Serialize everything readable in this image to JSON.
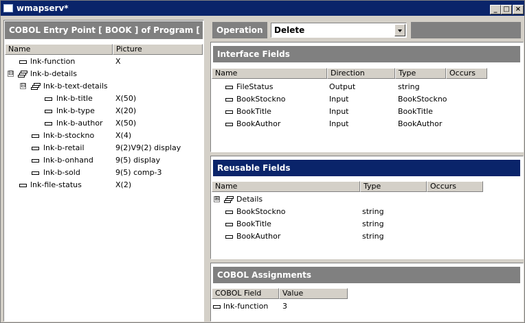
{
  "window": {
    "title": "wmapserv*",
    "min_label": "_",
    "max_label": "□",
    "close_label": "×"
  },
  "left": {
    "header": "COBOL Entry Point [ BOOK ] of Program [ B",
    "columns": [
      "Name",
      "Picture"
    ],
    "rows": [
      {
        "name": "lnk-function",
        "picture": "X",
        "kind": "field"
      },
      {
        "name": "lnk-b-details",
        "picture": "",
        "kind": "group",
        "expander": "⊟"
      },
      {
        "name": "lnk-b-text-details",
        "picture": "",
        "kind": "group",
        "expander": "⊟"
      },
      {
        "name": "lnk-b-title",
        "picture": "X(50)",
        "kind": "field"
      },
      {
        "name": "lnk-b-type",
        "picture": "X(20)",
        "kind": "field"
      },
      {
        "name": "lnk-b-author",
        "picture": "X(50)",
        "kind": "field"
      },
      {
        "name": "lnk-b-stockno",
        "picture": "X(4)",
        "kind": "field"
      },
      {
        "name": "lnk-b-retail",
        "picture": "9(2)V9(2) display",
        "kind": "field"
      },
      {
        "name": "lnk-b-onhand",
        "picture": "9(5) display",
        "kind": "field"
      },
      {
        "name": "lnk-b-sold",
        "picture": "9(5) comp-3",
        "kind": "field"
      },
      {
        "name": "lnk-file-status",
        "picture": "X(2)",
        "kind": "field"
      }
    ]
  },
  "operation": {
    "label": "Operation",
    "value": "Delete"
  },
  "interface": {
    "header": "Interface Fields",
    "columns": [
      "Name",
      "Direction",
      "Type",
      "Occurs"
    ],
    "rows": [
      {
        "name": "FileStatus",
        "direction": "Output",
        "type": "string"
      },
      {
        "name": "BookStockno",
        "direction": "Input",
        "type": "BookStockno"
      },
      {
        "name": "BookTitle",
        "direction": "Input",
        "type": "BookTitle"
      },
      {
        "name": "BookAuthor",
        "direction": "Input",
        "type": "BookAuthor"
      }
    ]
  },
  "reusable": {
    "header": "Reusable Fields",
    "columns": [
      "Name",
      "Type",
      "Occurs"
    ],
    "rows": [
      {
        "name": "Details",
        "type": "",
        "kind": "group",
        "expander": "⊞"
      },
      {
        "name": "BookStockno",
        "type": "string",
        "kind": "field"
      },
      {
        "name": "BookTitle",
        "type": "string",
        "kind": "field"
      },
      {
        "name": "BookAuthor",
        "type": "string",
        "kind": "field"
      }
    ]
  },
  "assignments": {
    "header": "COBOL Assignments",
    "columns": [
      "COBOL Field",
      "Value"
    ],
    "rows": [
      {
        "field": "lnk-function",
        "value": "3"
      }
    ]
  },
  "colors": {
    "title_bar": "#0a246a",
    "panel_header_gray": "#808080",
    "panel_header_active": "#0a246a",
    "chrome": "#d4d0c8"
  }
}
